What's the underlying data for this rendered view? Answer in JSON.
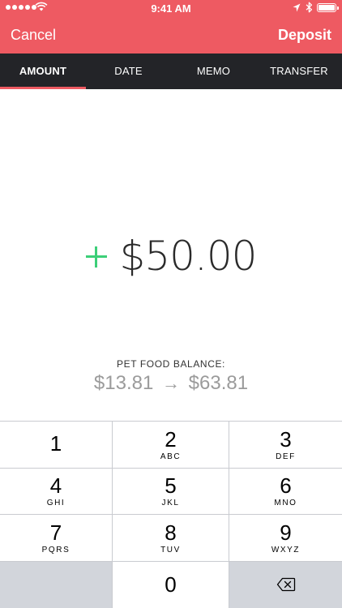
{
  "status_bar": {
    "time": "9:41 AM",
    "icons": [
      "signal-dots-icon",
      "wifi-icon",
      "location-icon",
      "bluetooth-icon",
      "battery-icon"
    ]
  },
  "nav": {
    "cancel_label": "Cancel",
    "deposit_label": "Deposit",
    "background_color": "#ee5a62"
  },
  "tabs": [
    {
      "label": "AMOUNT",
      "active": true
    },
    {
      "label": "DATE",
      "active": false
    },
    {
      "label": "MEMO",
      "active": false
    },
    {
      "label": "TRANSFER",
      "active": false
    }
  ],
  "amount": {
    "sign_icon": "plus-icon",
    "sign_color": "#3ccf78",
    "value": "$50.00"
  },
  "balance": {
    "label": "PET FOOD BALANCE:",
    "from": "$13.81",
    "arrow": "→",
    "to": "$63.81"
  },
  "keypad": {
    "rows": [
      [
        {
          "digit": "1",
          "letters": ""
        },
        {
          "digit": "2",
          "letters": "ABC"
        },
        {
          "digit": "3",
          "letters": "DEF"
        }
      ],
      [
        {
          "digit": "4",
          "letters": "GHI"
        },
        {
          "digit": "5",
          "letters": "JKL"
        },
        {
          "digit": "6",
          "letters": "MNO"
        }
      ],
      [
        {
          "digit": "7",
          "letters": "PQRS"
        },
        {
          "digit": "8",
          "letters": "TUV"
        },
        {
          "digit": "9",
          "letters": "WXYZ"
        }
      ]
    ],
    "zero": {
      "digit": "0"
    },
    "delete_icon": "backspace-icon"
  }
}
